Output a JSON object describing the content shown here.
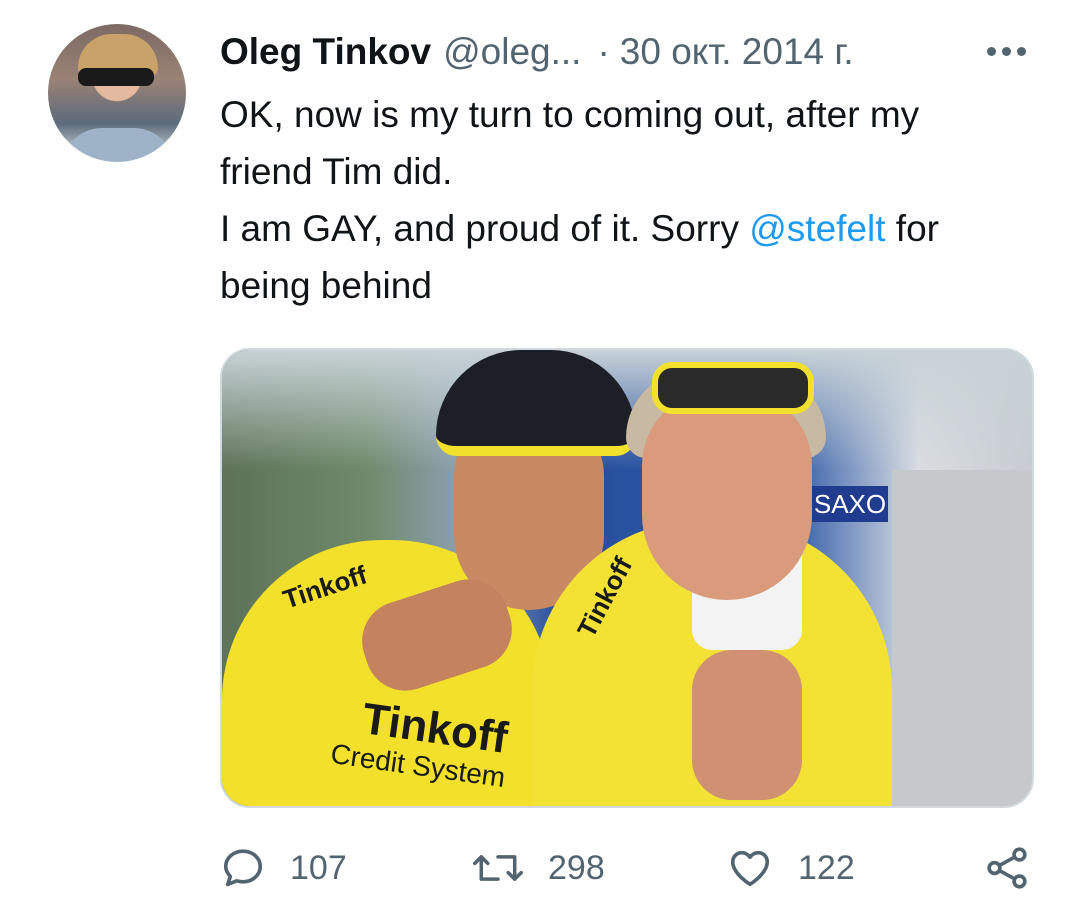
{
  "tweet": {
    "author_name": "Oleg Tinkov",
    "author_handle": "@oleg...",
    "separator": "·",
    "date": "30 окт. 2014 г.",
    "text_lines": [
      "OK, now is my turn to coming out, after my",
      "friend Tim did.",
      "I am GAY, and proud of it. Sorry ",
      "being behind"
    ],
    "mention": "@stefelt",
    "mention_suffix": " for",
    "media_jersey_text": {
      "t1": "Tinkoff",
      "t2": "Tinkoff",
      "t3": "Tinkoff",
      "t4": "Credit System",
      "saxo": "SAXO"
    }
  },
  "actions": {
    "reply_count": "107",
    "retweet_count": "298",
    "like_count": "122"
  },
  "icons": {
    "more": "more-dots-icon",
    "reply": "reply-icon",
    "retweet": "retweet-icon",
    "like": "heart-icon",
    "share": "share-icon"
  },
  "colors": {
    "text": "#0f1419",
    "secondary": "#536471",
    "link": "#1d9bf0"
  }
}
